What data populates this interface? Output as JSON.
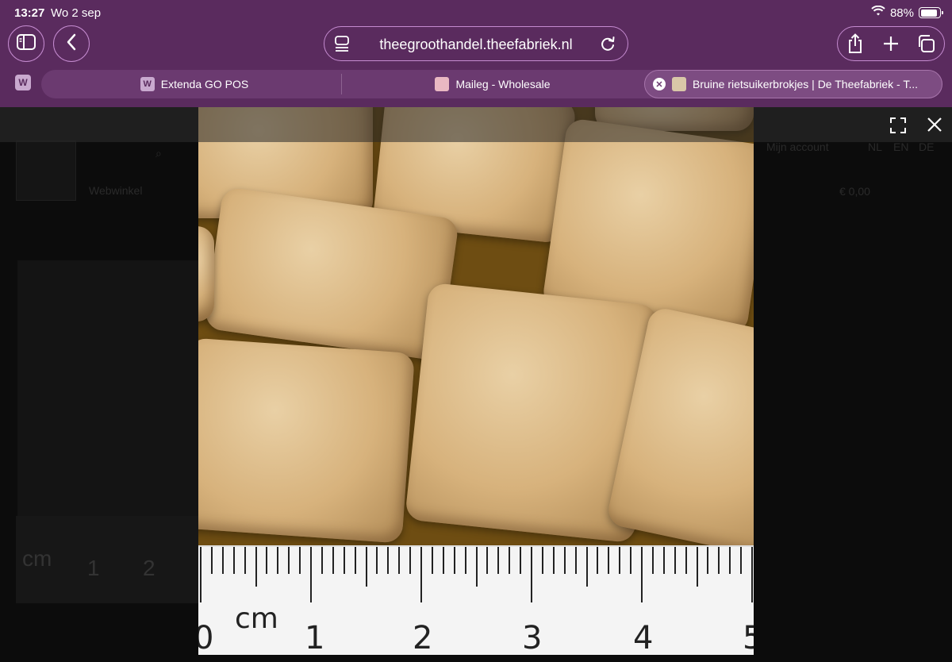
{
  "status_bar": {
    "time": "13:27",
    "date": "Wo 2 sep",
    "battery_percent": "88%",
    "battery_level": 0.88
  },
  "toolbar": {
    "url": "theegroothandel.theefabriek.nl",
    "icons": {
      "sidebar": "sidebar-icon",
      "back": "chevron-left-icon",
      "reader": "reader-icon",
      "reload": "reload-icon",
      "share": "share-icon",
      "new_tab": "plus-icon",
      "tabs": "tabs-overview-icon"
    }
  },
  "tabs": {
    "pinned_favicon": "W",
    "items": [
      {
        "label": "Extenda GO POS",
        "favicon": "W"
      },
      {
        "label": "Maileg - Wholesale",
        "favicon": ""
      },
      {
        "label": "Bruine rietsuikerbrokjes | De Theefabriek - T...",
        "favicon": "",
        "active": true
      }
    ]
  },
  "lightbox": {
    "expand_icon": "fullscreen-icon",
    "close_icon": "close-icon"
  },
  "ruler": {
    "unit": "cm",
    "numbers": [
      "0",
      "1",
      "2",
      "3",
      "4",
      "5"
    ]
  },
  "background_page": {
    "links": [
      "Webwinkel",
      "Mijn account",
      "NL",
      "EN",
      "DE"
    ],
    "cart": "€ 0,00",
    "ruler_unit": "cm",
    "ruler_numbers": [
      "1",
      "2"
    ]
  },
  "colors": {
    "chrome": "#5a2b5e",
    "tab_strip": "#6b3a70",
    "active_tab": "#7d4c82",
    "border_accent": "#c58bd0"
  }
}
